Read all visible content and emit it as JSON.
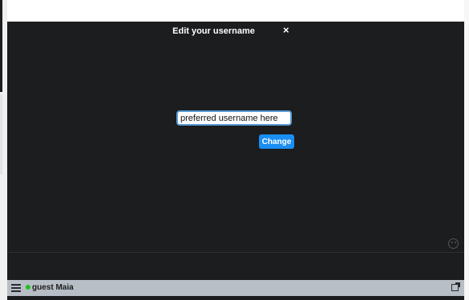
{
  "modal": {
    "title": "Edit your username",
    "close_label": "×",
    "input_value": "preferred username here",
    "change_label": "Change"
  },
  "statusbar": {
    "username": "guest Maia",
    "status_color": "#22c01f"
  },
  "icons": {
    "menu": "hamburger-menu-icon",
    "popout": "external-window-icon",
    "emoji": "smiley-icon",
    "close": "close-icon"
  },
  "colors": {
    "widget_bg": "#1c1d1e",
    "accent": "#1a8ef3",
    "statusbar_bg": "#b8bec6"
  }
}
